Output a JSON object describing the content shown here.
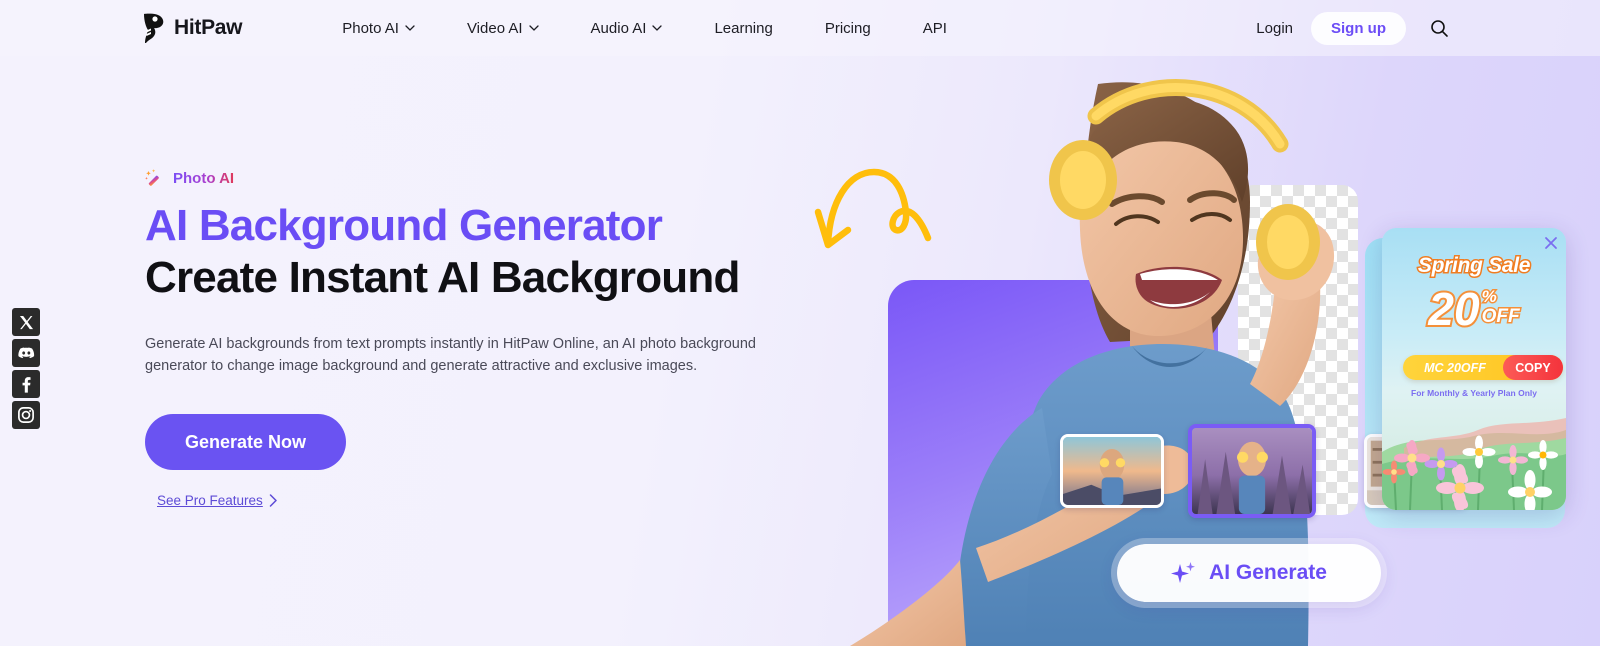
{
  "brand": {
    "name": "HitPaw",
    "logo_icon": "hitpaw-paw-logo"
  },
  "header": {
    "nav": [
      {
        "label": "Photo AI",
        "has_dropdown": true
      },
      {
        "label": "Video AI",
        "has_dropdown": true
      },
      {
        "label": "Audio AI",
        "has_dropdown": true
      },
      {
        "label": "Learning",
        "has_dropdown": false
      },
      {
        "label": "Pricing",
        "has_dropdown": false
      },
      {
        "label": "API",
        "has_dropdown": false
      }
    ],
    "login_label": "Login",
    "signup_label": "Sign up",
    "search_icon": "search-icon",
    "signup_color": "#6c4df6"
  },
  "social": [
    {
      "name": "x-twitter",
      "glyph": "X"
    },
    {
      "name": "discord",
      "glyph": "discord"
    },
    {
      "name": "facebook",
      "glyph": "f"
    },
    {
      "name": "instagram",
      "glyph": "instagram"
    }
  ],
  "hero": {
    "badge_label": "Photo AI",
    "badge_icon": "magic-wand-icon",
    "title_line1": "AI Background Generator",
    "title_line2": "Create Instant AI Background",
    "description": "Generate AI backgrounds from text prompts instantly in HitPaw Online, an AI photo background generator to change image background and generate attractive and exclusive images.",
    "cta_label": "Generate Now",
    "pro_link_label": "See Pro Features",
    "accent_purple": "#6a4df5",
    "cta_bg": "#6a53f2"
  },
  "visual": {
    "ai_generate_label": "AI Generate",
    "ai_generate_icon": "sparkle-icon",
    "arrow_icon": "curved-arrow-icon",
    "arrow_color": "#ffbe0b",
    "thumbnails": [
      {
        "name": "thumb-sunset-background",
        "selected": false
      },
      {
        "name": "thumb-forest-background",
        "selected": true
      },
      {
        "name": "thumb-room-background",
        "selected": false
      }
    ]
  },
  "promo": {
    "title": "Spring Sale",
    "discount": "20",
    "percent": "%",
    "off": "OFF",
    "coupon_code": "MC 20OFF",
    "copy_label": "COPY",
    "note": "For Monthly & Yearly Plan Only",
    "close_icon": "close-icon",
    "title_color": "#ffffff",
    "title_stroke": "#f07d22"
  }
}
